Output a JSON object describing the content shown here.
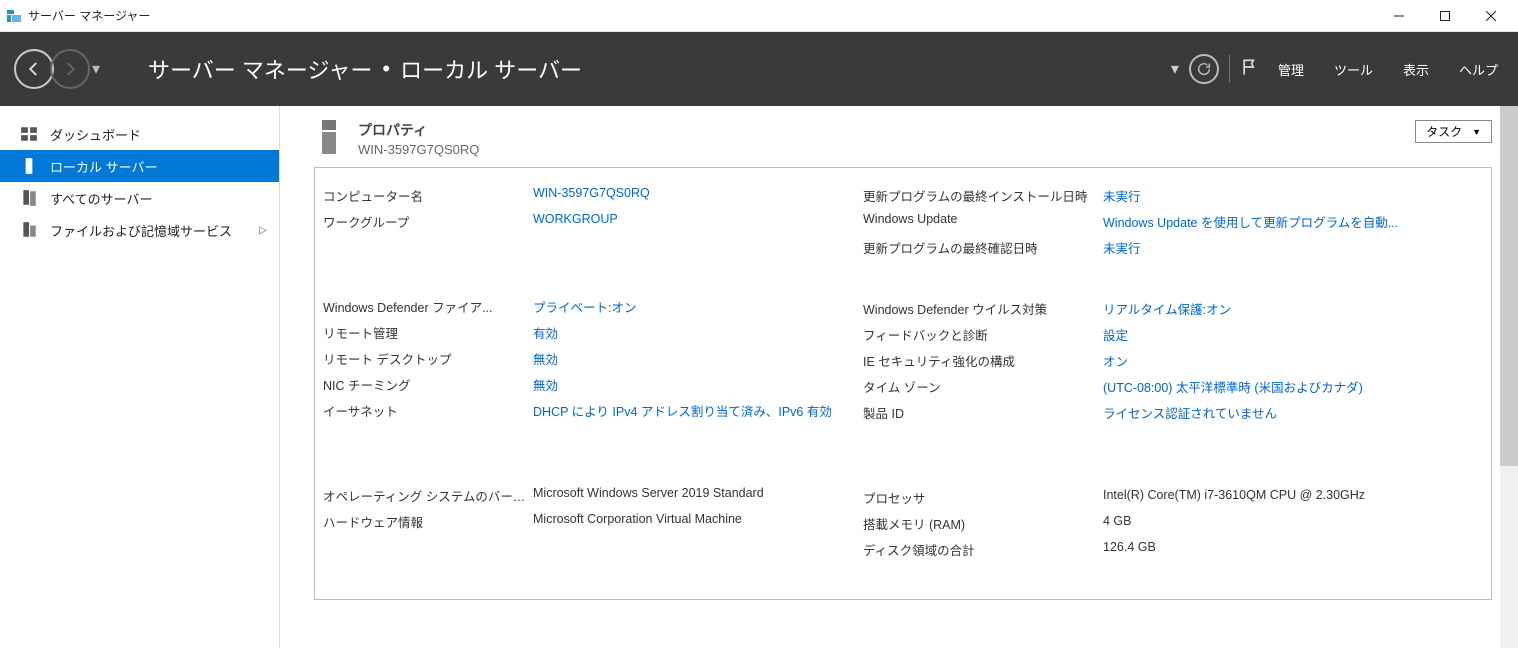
{
  "window": {
    "title": "サーバー マネージャー"
  },
  "ribbon": {
    "crumb1": "サーバー マネージャー",
    "crumb2": "ローカル サーバー",
    "menu": {
      "manage": "管理",
      "tools": "ツール",
      "view": "表示",
      "help": "ヘルプ"
    }
  },
  "sidebar": {
    "items": [
      {
        "label": "ダッシュボード",
        "icon": "dashboard"
      },
      {
        "label": "ローカル サーバー",
        "icon": "local-server",
        "active": true
      },
      {
        "label": "すべてのサーバー",
        "icon": "all-servers"
      },
      {
        "label": "ファイルおよび記憶域サービス",
        "icon": "file-storage",
        "expandable": true
      }
    ]
  },
  "properties": {
    "title": "プロパティ",
    "subtitle": "WIN-3597G7QS0RQ",
    "task_label": "タスク",
    "left": {
      "computer_name": {
        "label": "コンピューター名",
        "value": "WIN-3597G7QS0RQ",
        "link": true
      },
      "workgroup": {
        "label": "ワークグループ",
        "value": "WORKGROUP",
        "link": true
      },
      "defender_fw": {
        "label": "Windows Defender ファイア...",
        "value": "プライベート:オン",
        "link": true
      },
      "remote_mgmt": {
        "label": "リモート管理",
        "value": "有効",
        "link": true
      },
      "remote_desktop": {
        "label": "リモート デスクトップ",
        "value": "無効",
        "link": true
      },
      "nic_teaming": {
        "label": "NIC チーミング",
        "value": "無効",
        "link": true
      },
      "ethernet": {
        "label": "イーサネット",
        "value": "DHCP により IPv4 アドレス割り当て済み、IPv6 有効",
        "link": true
      },
      "os_version": {
        "label": "オペレーティング システムのバージョン",
        "value": "Microsoft Windows Server 2019 Standard",
        "link": false
      },
      "hw_info": {
        "label": "ハードウェア情報",
        "value": "Microsoft Corporation Virtual Machine",
        "link": false
      }
    },
    "right": {
      "last_installed": {
        "label": "更新プログラムの最終インストール日時",
        "value": "未実行",
        "link": true
      },
      "windows_update": {
        "label": "Windows Update",
        "value": "Windows Update を使用して更新プログラムを自動...",
        "link": true
      },
      "last_checked": {
        "label": "更新プログラムの最終確認日時",
        "value": "未実行",
        "link": true
      },
      "defender_av": {
        "label": "Windows Defender ウイルス対策",
        "value": "リアルタイム保護:オン",
        "link": true
      },
      "feedback": {
        "label": "フィードバックと診断",
        "value": "設定",
        "link": true
      },
      "ie_esc": {
        "label": "IE セキュリティ強化の構成",
        "value": "オン",
        "link": true
      },
      "timezone": {
        "label": "タイム ゾーン",
        "value": "(UTC-08:00) 太平洋標準時 (米国およびカナダ)",
        "link": true
      },
      "product_id": {
        "label": "製品 ID",
        "value": "ライセンス認証されていません",
        "link": true
      },
      "processor": {
        "label": "プロセッサ",
        "value": "Intel(R) Core(TM) i7-3610QM CPU @ 2.30GHz",
        "link": false
      },
      "ram": {
        "label": "搭載メモリ (RAM)",
        "value": "4 GB",
        "link": false
      },
      "disk": {
        "label": "ディスク領域の合計",
        "value": "126.4 GB",
        "link": false
      }
    }
  }
}
